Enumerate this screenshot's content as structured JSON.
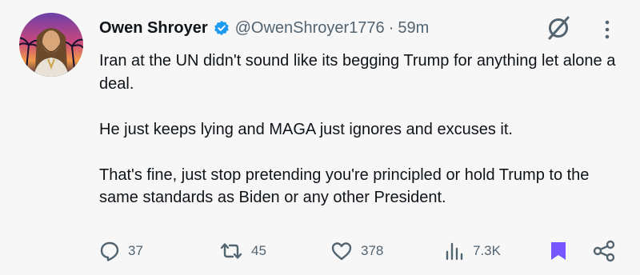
{
  "author": {
    "name": "Owen Shroyer",
    "handle": "@OwenShroyer1776",
    "separator": "·",
    "time": "59m",
    "verified": true
  },
  "tweet": {
    "paragraphs": [
      "Iran at the UN didn't sound like its begging Trump for anything let alone a deal.",
      "He just keeps lying and MAGA just ignores and excuses it.",
      "That's fine, just stop pretending you're principled or hold Trump to the same standards as Biden or any other President."
    ]
  },
  "metrics": {
    "replies": "37",
    "reposts": "45",
    "likes": "378",
    "views": "7.3K"
  },
  "icons": {
    "verified": "verified-badge-icon",
    "grok": "grok-icon",
    "more": "more-icon",
    "reply": "reply-icon",
    "repost": "repost-icon",
    "like": "like-icon",
    "views": "views-icon",
    "bookmark": "bookmark-icon",
    "share": "share-icon"
  },
  "colors": {
    "verified": "#1d9bf0",
    "bookmark": "#7856ff",
    "secondary_text": "#536471",
    "primary_text": "#0f1419"
  }
}
